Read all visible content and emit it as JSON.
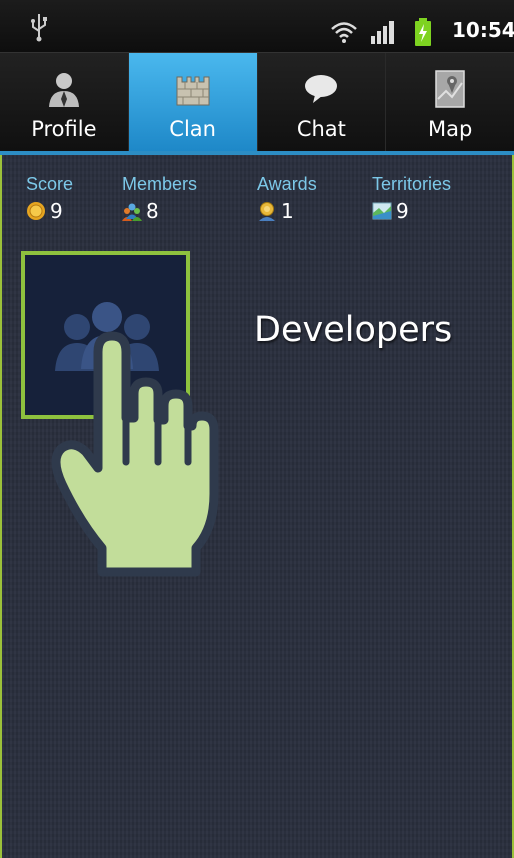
{
  "status_bar": {
    "time": "10:54",
    "icons": [
      "usb-icon",
      "wifi-icon",
      "signal-icon",
      "battery-charging-icon"
    ]
  },
  "tabs": [
    {
      "label": "Profile",
      "icon": "profile-icon",
      "active": false
    },
    {
      "label": "Clan",
      "icon": "castle-icon",
      "active": true
    },
    {
      "label": "Chat",
      "icon": "chat-bubble-icon",
      "active": false
    },
    {
      "label": "Map",
      "icon": "map-icon",
      "active": false
    }
  ],
  "stats": [
    {
      "label": "Score",
      "value": "9",
      "icon": "coin-icon"
    },
    {
      "label": "Members",
      "value": "8",
      "icon": "members-icon"
    },
    {
      "label": "Awards",
      "value": "1",
      "icon": "award-icon"
    },
    {
      "label": "Territories",
      "value": "9",
      "icon": "territory-icon"
    }
  ],
  "clan": {
    "name": "Developers",
    "avatar_icon": "group-icon"
  },
  "overlay": {
    "icon": "tap-hand-icon"
  },
  "colors": {
    "accent_green": "#8ec23e",
    "tab_active": "#2c8dc4",
    "stat_label": "#7cc8e8",
    "background": "#2a2f3e"
  }
}
